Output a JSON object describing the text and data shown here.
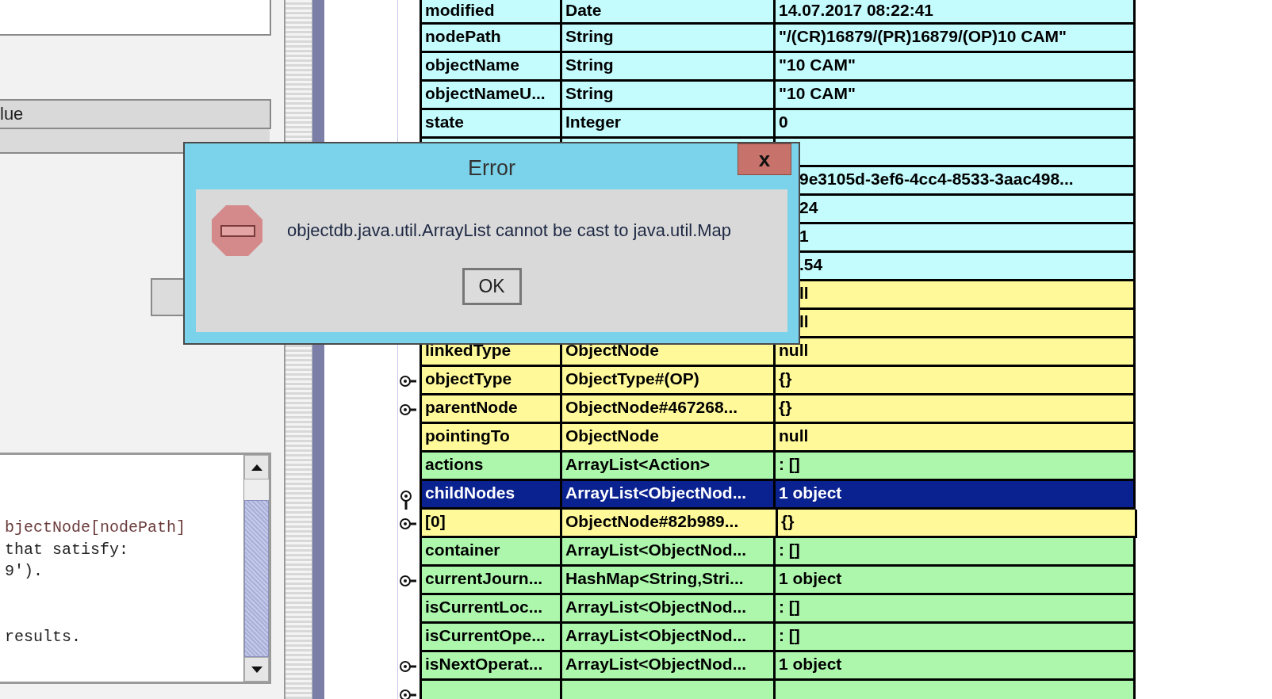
{
  "left_panel": {
    "header_label": "lue",
    "code_paragraphs": [
      [
        "bjectNode[nodePath]",
        "that satisfy:",
        "9')."
      ],
      [
        "results."
      ]
    ]
  },
  "object_table": {
    "rows": [
      {
        "kind": "field",
        "name": "modified",
        "type": "Date",
        "value": "14.07.2017 08:22:41",
        "color": "#c4fbfd",
        "selected": false
      },
      {
        "kind": "field",
        "name": "nodePath",
        "type": "String",
        "value": "\"/(CR)16879/(PR)16879/(OP)10 CAM\"",
        "color": "#c4fbfd",
        "selected": false
      },
      {
        "kind": "field",
        "name": "objectName",
        "type": "String",
        "value": "\"10 CAM\"",
        "color": "#c4fbfd",
        "selected": false
      },
      {
        "kind": "field",
        "name": "objectNameU...",
        "type": "String",
        "value": "\"10 CAM\"",
        "color": "#c4fbfd",
        "selected": false
      },
      {
        "kind": "field",
        "name": "state",
        "type": "Integer",
        "value": "0",
        "color": "#c4fbfd",
        "selected": false
      },
      {
        "kind": "covered",
        "color": "#c4fbfd",
        "selected": false
      },
      {
        "kind": "covered",
        "value": "9e3105d-3ef6-4cc4-8533-3aac498...",
        "color": "#c4fbfd",
        "selected": false
      },
      {
        "kind": "covered",
        "value": "24",
        "color": "#c4fbfd",
        "selected": false
      },
      {
        "kind": "covered",
        "value": "1",
        "color": "#c4fbfd",
        "selected": false
      },
      {
        "kind": "covered",
        "value": ".54",
        "color": "#c4fbfd",
        "selected": false
      },
      {
        "kind": "covered",
        "value": "ll",
        "color": "#fff99a",
        "selected": false
      },
      {
        "kind": "covered",
        "value": "ll",
        "color": "#fff99a",
        "selected": false
      },
      {
        "kind": "field",
        "name": "linkedType",
        "type": "ObjectNode",
        "value": "null",
        "color": "#fff99a",
        "selected": false
      },
      {
        "kind": "field",
        "name": "objectType",
        "type": "ObjectType#(OP)",
        "value": "{}",
        "color": "#fff99a",
        "selected": false,
        "expanded": false
      },
      {
        "kind": "field",
        "name": "parentNode",
        "type": "ObjectNode#467268...",
        "value": "{}",
        "color": "#fff99a",
        "selected": false,
        "expanded": false
      },
      {
        "kind": "field",
        "name": "pointingTo",
        "type": "ObjectNode",
        "value": "null",
        "color": "#fff99a",
        "selected": false
      },
      {
        "kind": "field",
        "name": "actions",
        "type": "ArrayList<Action>",
        "value": ": []",
        "color": "#adf7ad",
        "selected": false
      },
      {
        "kind": "field",
        "name": "childNodes",
        "type": "ArrayList<ObjectNod...",
        "value": "1 object",
        "selected": true,
        "expanded": true,
        "children": [
          {
            "kind": "field",
            "name": "[0]",
            "type": "ObjectNode#82b989...",
            "value": "{}",
            "color": "#fff99a",
            "selected": false,
            "expanded": false
          }
        ]
      },
      {
        "kind": "field",
        "name": "container",
        "type": "ArrayList<ObjectNod...",
        "value": ": []",
        "color": "#adf7ad",
        "selected": false
      },
      {
        "kind": "field",
        "name": "currentJourn...",
        "type": "HashMap<String,Stri...",
        "value": "1 object",
        "color": "#adf7ad",
        "selected": false,
        "expanded": false
      },
      {
        "kind": "field",
        "name": "isCurrentLoc...",
        "type": "ArrayList<ObjectNod...",
        "value": ": []",
        "color": "#adf7ad",
        "selected": false
      },
      {
        "kind": "field",
        "name": "isCurrentOpe...",
        "type": "ArrayList<ObjectNod...",
        "value": ": []",
        "color": "#adf7ad",
        "selected": false
      },
      {
        "kind": "field",
        "name": "isNextOperat...",
        "type": "ArrayList<ObjectNod...",
        "value": "1 object",
        "color": "#adf7ad",
        "selected": false,
        "expanded": false
      },
      {
        "kind": "cut",
        "color": "#adf7ad",
        "selected": false,
        "expanded": false
      }
    ]
  },
  "error_dialog": {
    "title": "Error",
    "close_label": "x",
    "message": "objectdb.java.util.ArrayList cannot be cast to java.util.Map",
    "ok_label": "OK"
  }
}
